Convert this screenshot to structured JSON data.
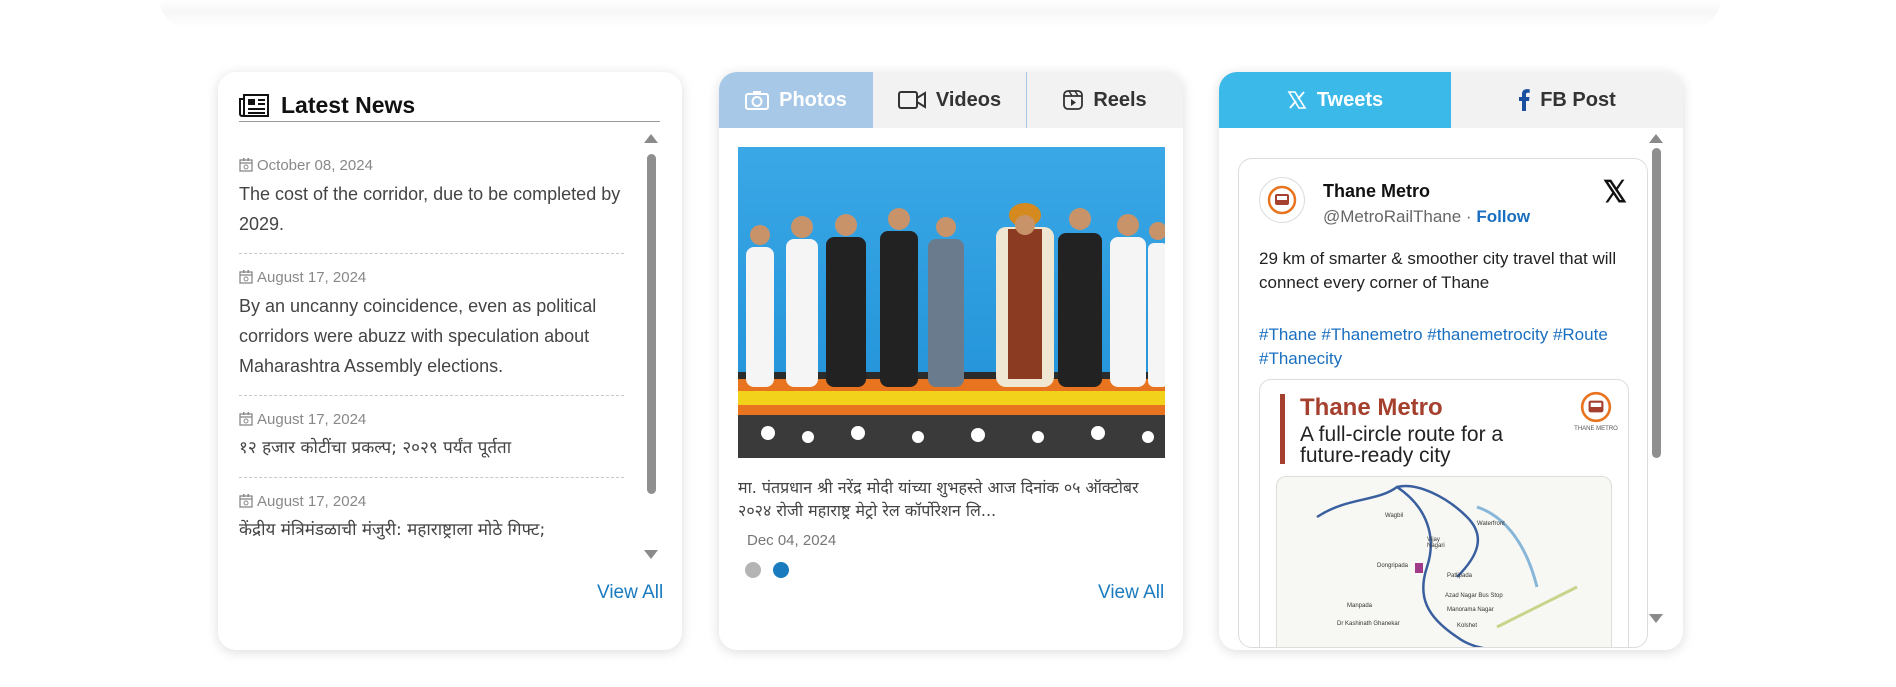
{
  "news": {
    "title": "Latest News",
    "view_all": "View All",
    "items": [
      {
        "date": "October 08, 2024",
        "text": "The cost of the corridor, due to be completed by 2029."
      },
      {
        "date": "August 17, 2024",
        "text": "By an uncanny coincidence, even as political corridors were abuzz with speculation about Maharashtra Assembly elections."
      },
      {
        "date": "August 17, 2024",
        "text": "१२ हजार कोटींचा प्रकल्प; २०२९ पर्यंत पूर्तता"
      },
      {
        "date": "August 17, 2024",
        "text": "केंद्रीय मंत्रिमंडळाची मंजुरी: महाराष्ट्राला मोठे गिफ्ट;"
      }
    ]
  },
  "media": {
    "tabs": [
      {
        "label": "Photos",
        "icon": "camera-icon",
        "active": true
      },
      {
        "label": "Videos",
        "icon": "video-icon",
        "active": false
      },
      {
        "label": "Reels",
        "icon": "reels-icon",
        "active": false
      }
    ],
    "caption": "मा. पंतप्रधान श्री नरेंद्र मोदी यांच्या शुभहस्ते आज दिनांक ०५ ऑक्टोबर २०२४ रोजी महाराष्ट्र मेट्रो रेल कॉर्पोरेशन लि...",
    "date": "Dec 04, 2024",
    "view_all": "View All",
    "slides": 2,
    "active_slide": 2,
    "colors": {
      "active_tab": "#a7c8e6",
      "accent": "#1a7bbf"
    }
  },
  "social": {
    "tabs": [
      {
        "label": "Tweets",
        "icon": "x-logo-icon",
        "active": true
      },
      {
        "label": "FB Post",
        "icon": "facebook-icon",
        "active": false
      }
    ],
    "tweet": {
      "name": "Thane Metro",
      "handle": "@MetroRailThane",
      "separator": " · ",
      "follow": "Follow",
      "text": "29 km of smarter & smoother city travel that will connect every corner of Thane",
      "hashtags": [
        "#Thane",
        "#Thanemetro",
        "#thanemetrocity",
        "#Route",
        "#Thanecity"
      ],
      "card_title": "Thane Metro",
      "card_subtitle": "A full-circle route for a future-ready city",
      "logo_text": "THANE METRO",
      "map_labels": [
        "Wagbil",
        "Waterfront",
        "Vijay Nagari",
        "Dongripada",
        "Patlipada",
        "Azad Nagar Bus Stop",
        "Manpada",
        "Manorama Nagar",
        "Dr Kashinath Ghanekar",
        "Kolshet"
      ]
    },
    "colors": {
      "active_tab": "#3bb9e9",
      "link": "#1a6fc0",
      "brand": "#a5402e"
    }
  }
}
